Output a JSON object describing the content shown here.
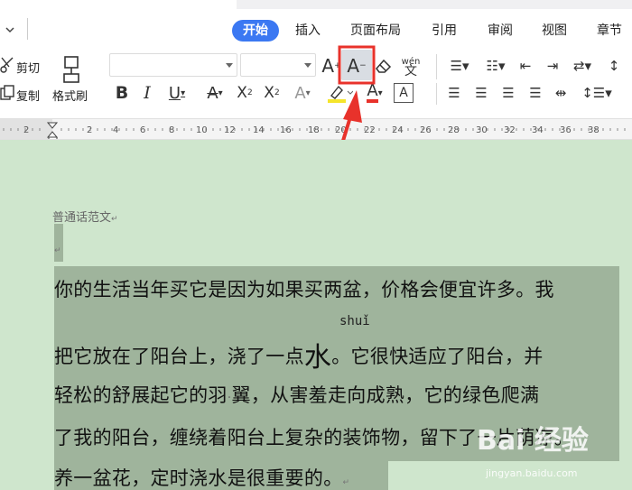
{
  "tabs": [
    {
      "label": "开始"
    },
    {
      "label": "插入"
    },
    {
      "label": "页面布局"
    },
    {
      "label": "引用"
    },
    {
      "label": "审阅"
    },
    {
      "label": "视图"
    },
    {
      "label": "章节"
    }
  ],
  "clipboard": {
    "cut": "剪切",
    "copy": "复制",
    "format_painter": "格式刷"
  },
  "font": {
    "name": "",
    "size": ""
  },
  "ruler": {
    "ticks": [
      "2",
      "2",
      "4",
      "6",
      "8",
      "10",
      "12",
      "14",
      "16",
      "18",
      "20",
      "22",
      "24",
      "26",
      "28",
      "30",
      "32",
      "34",
      "36",
      "38"
    ]
  },
  "document": {
    "heading": "普通话范文",
    "pinyin": "shuǐ",
    "lines": [
      "你的生活当年买它是因为如果买两盆，价格会便宜许多。我",
      "把它放在了阳台上，浇了一点",
      "轻松的舒展起它的羽",
      "了我的阳台，缠绕着阳台上复杂的装饰物，留下了一片荫凉。",
      "养一盆花，定时浇水是很重要的。"
    ],
    "line2_big": "水",
    "line2_tail": "。它很快适应了阳台，并",
    "line3_tail": "翼，从害羞走向成熟，它的绿色爬满"
  },
  "watermark": {
    "brand": "Bai 经验",
    "site": "jingyan.baidu.com"
  },
  "colors": {
    "accent": "#3b78f2",
    "selection": "#9fb49c",
    "page_bg": "#cfe6cd",
    "arrow": "#e8322b"
  }
}
